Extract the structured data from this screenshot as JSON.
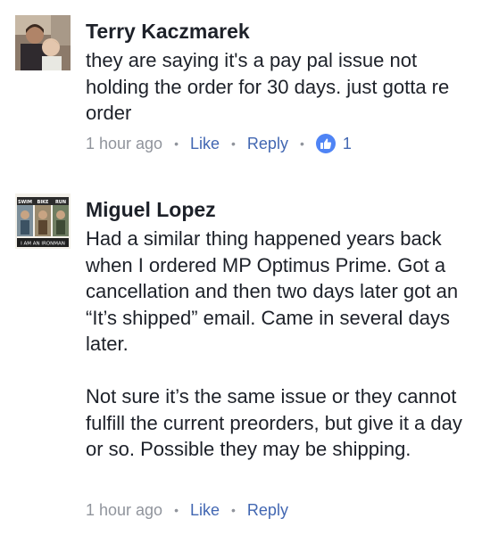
{
  "comments": [
    {
      "author": "Terry Kaczmarek",
      "body": [
        "they are saying it's a pay pal issue not holding the order for 30 days. just gotta re order"
      ],
      "time": "1 hour ago",
      "like_label": "Like",
      "reply_label": "Reply",
      "reaction_icon": "thumbs-up-icon",
      "reaction_count": "1"
    },
    {
      "author": "Miguel Lopez",
      "body": [
        "Had a similar thing happened years back when I ordered MP Optimus Prime. Got a cancellation and then two days later got an “It’s shipped” email. Came in several days later.",
        "Not sure it’s the same issue or they cannot fulfill the current preorders, but give it a day or so. Possible they may be shipping."
      ],
      "time": "1 hour ago",
      "like_label": "Like",
      "reply_label": "Reply",
      "avatar_text": {
        "top_left": "SWIM",
        "top_middle": "BIKE",
        "top_right": "RUN",
        "bottom": "I AM AN IRONMAN"
      }
    }
  ],
  "colors": {
    "link": "#4267b2",
    "meta": "#90949c",
    "reaction": "#4f84f5"
  }
}
